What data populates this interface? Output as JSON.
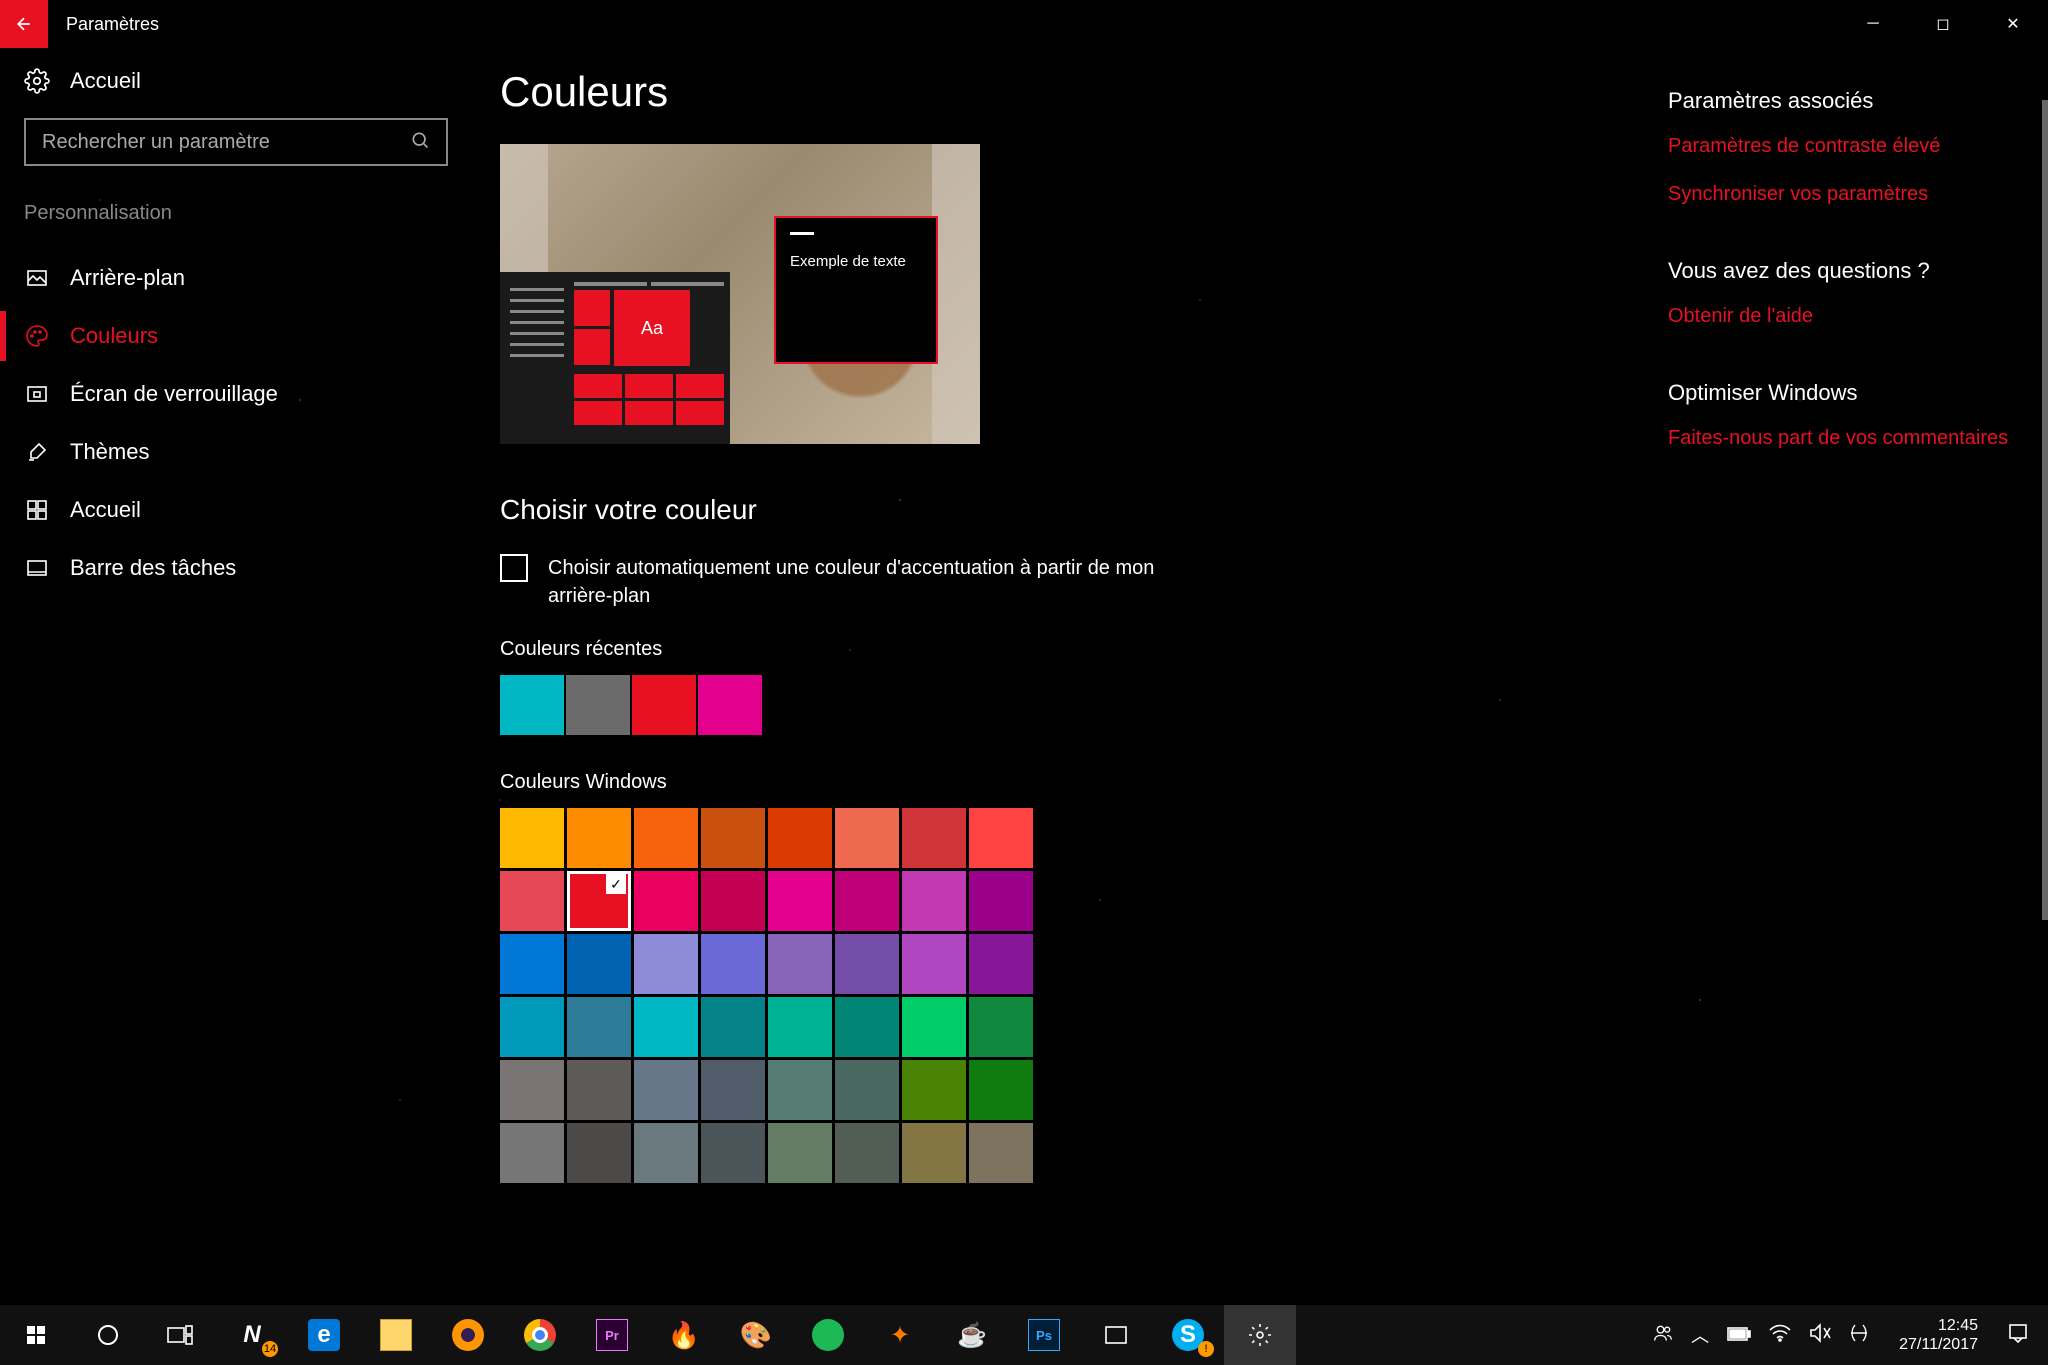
{
  "titlebar": {
    "title": "Paramètres"
  },
  "sidebar": {
    "home": "Accueil",
    "search_placeholder": "Rechercher un paramètre",
    "section": "Personnalisation",
    "items": [
      {
        "label": "Arrière-plan"
      },
      {
        "label": "Couleurs"
      },
      {
        "label": "Écran de verrouillage"
      },
      {
        "label": "Thèmes"
      },
      {
        "label": "Accueil"
      },
      {
        "label": "Barre des tâches"
      }
    ]
  },
  "main": {
    "title": "Couleurs",
    "preview_sample": "Exemple de texte",
    "preview_aa": "Aa",
    "choose_heading": "Choisir votre couleur",
    "auto_checkbox": "Choisir automatiquement une couleur d'accentuation à partir de mon arrière-plan",
    "recent_label": "Couleurs récentes",
    "recent_colors": [
      "#00b7c3",
      "#6b6b6b",
      "#e81123",
      "#e3008c"
    ],
    "windows_label": "Couleurs Windows",
    "windows_colors": [
      "#ffb900",
      "#ff8c00",
      "#f7630c",
      "#ca5010",
      "#da3b01",
      "#ef6950",
      "#d13438",
      "#ff4343",
      "#e74856",
      "#e81123",
      "#ea005e",
      "#c30052",
      "#e3008c",
      "#bf0077",
      "#c239b3",
      "#9a0089",
      "#0078d7",
      "#0063b1",
      "#8e8cd8",
      "#6b69d6",
      "#8764b8",
      "#744da9",
      "#b146c2",
      "#881798",
      "#0099bc",
      "#2d7d9a",
      "#00b7c3",
      "#038387",
      "#00b294",
      "#018574",
      "#00cc6a",
      "#10893e",
      "#7a7574",
      "#5d5a58",
      "#68768a",
      "#515c6b",
      "#567c73",
      "#486860",
      "#498205",
      "#107c10",
      "#767676",
      "#4c4a48",
      "#69797e",
      "#4a5459",
      "#647c64",
      "#525e54",
      "#847545",
      "#7e735f"
    ],
    "selected_color_index": 9
  },
  "right": {
    "g1_heading": "Paramètres associés",
    "g1_link1": "Paramètres de contraste élevé",
    "g1_link2": "Synchroniser vos paramètres",
    "g2_heading": "Vous avez des questions ?",
    "g2_link1": "Obtenir de l'aide",
    "g3_heading": "Optimiser Windows",
    "g3_link1": "Faites-nous part de vos commentaires"
  },
  "taskbar": {
    "n_badge": "14",
    "clock_time": "12:45",
    "clock_date": "27/11/2017"
  }
}
